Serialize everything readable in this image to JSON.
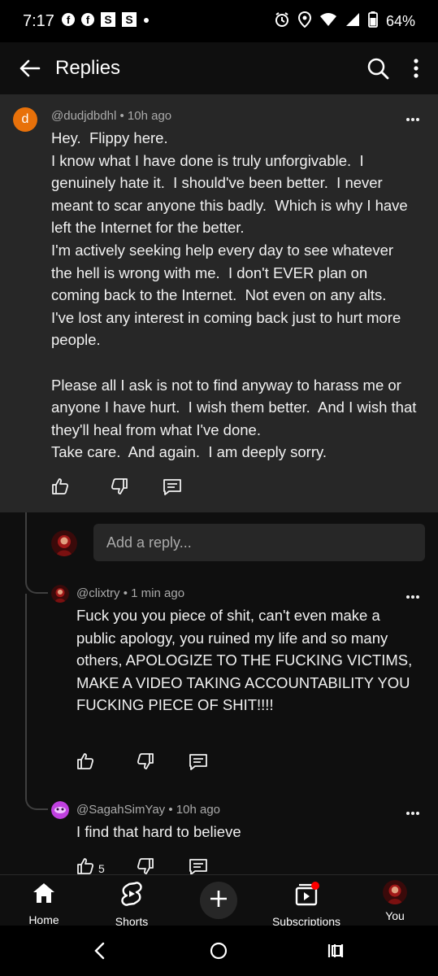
{
  "status_bar": {
    "time": "7:17",
    "battery": "64%",
    "left_icons": [
      "facebook-icon",
      "facebook-icon",
      "s-app-icon",
      "s-app-icon",
      "dot-icon"
    ],
    "right_icons": [
      "alarm-icon",
      "location-icon",
      "wifi-icon",
      "signal-icon",
      "battery-icon"
    ]
  },
  "header": {
    "title": "Replies"
  },
  "main_comment": {
    "avatar_letter": "d",
    "author": "@dudjdbdhl",
    "time": "10h ago",
    "body": "Hey.  Flippy here.\nI know what I have done is truly unforgivable.  I genuinely hate it.  I should've been better.  I never meant to scar anyone this badly.  Which is why I have left the Internet for the better.\nI'm actively seeking help every day to see whatever the hell is wrong with me.  I don't EVER plan on coming back to the Internet.  Not even on any alts.  I've lost any interest in coming back just to hurt more people.\n\nPlease all I ask is not to find anyway to harass me or anyone I have hurt.  I wish them better.  And I wish that they'll heal from what I've done.\nTake care.  And again.  I am deeply sorry."
  },
  "reply_box": {
    "placeholder": "Add a reply..."
  },
  "replies": [
    {
      "author": "@clixtry",
      "time": "1 min ago",
      "body": "Fuck you you piece of shit, can't even make a public apology, you ruined my life and so many others, APOLOGIZE TO THE FUCKING VICTIMS, MAKE A VIDEO TAKING ACCOUNTABILITY YOU FUCKING PIECE OF SHIT!!!!",
      "likes": ""
    },
    {
      "author": "@SagahSimYay",
      "time": "10h ago",
      "body": "I find that hard to believe",
      "likes": "5"
    }
  ],
  "meta_separator": "•",
  "bottom_nav": {
    "home": "Home",
    "shorts": "Shorts",
    "subscriptions": "Subscriptions",
    "you": "You"
  },
  "colors": {
    "background": "#0f0f0f",
    "card": "#272727",
    "text": "#f1f1f1",
    "muted": "#aaaaaa",
    "accent_avatar": "#e8710a",
    "notification": "#ff0000"
  }
}
